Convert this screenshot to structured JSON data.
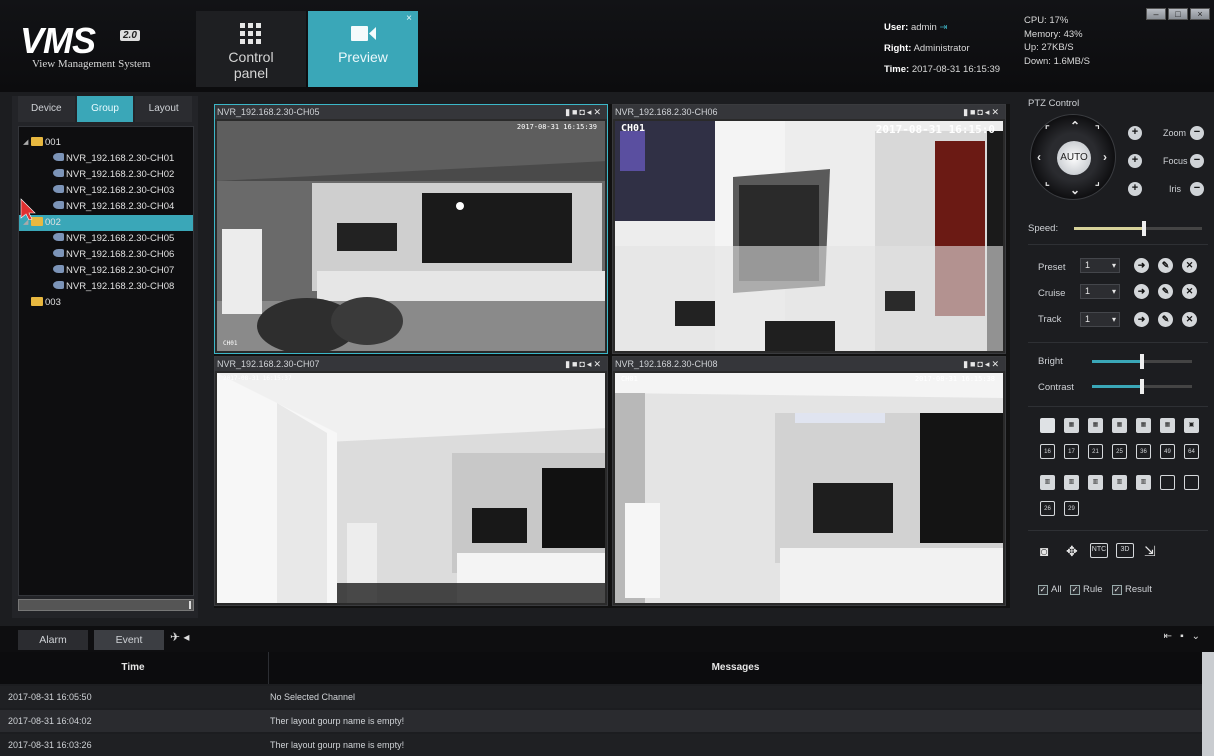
{
  "header": {
    "logo_text": "VMS",
    "logo_version": "2.0",
    "logo_subtitle": "View Management System",
    "tabs": [
      {
        "label": "Control panel",
        "active": false
      },
      {
        "label": "Preview",
        "active": true
      }
    ],
    "tab_close": "×",
    "user": {
      "user_label": "User:",
      "user_value": "admin",
      "right_label": "Right:",
      "right_value": "Administrator",
      "time_label": "Time:",
      "time_value": "2017-08-31 16:15:39"
    },
    "system": {
      "cpu": "CPU: 17%",
      "memory": "Memory: 43%",
      "up": "Up: 27KB/S",
      "down": "Down: 1.6MB/S"
    },
    "window_buttons": [
      "–",
      "□",
      "×"
    ]
  },
  "left_panel": {
    "tabs": [
      {
        "label": "Device",
        "active": false
      },
      {
        "label": "Group",
        "active": true
      },
      {
        "label": "Layout",
        "active": false
      }
    ],
    "tree": [
      {
        "label": "001",
        "type": "folder",
        "expand": "◢"
      },
      {
        "label": "NVR_192.168.2.30-CH01",
        "type": "camera"
      },
      {
        "label": "NVR_192.168.2.30-CH02",
        "type": "camera"
      },
      {
        "label": "NVR_192.168.2.30-CH03",
        "type": "camera"
      },
      {
        "label": "NVR_192.168.2.30-CH04",
        "type": "camera"
      },
      {
        "label": "002",
        "type": "folder",
        "selected": true,
        "expand": "◢"
      },
      {
        "label": "NVR_192.168.2.30-CH05",
        "type": "camera"
      },
      {
        "label": "NVR_192.168.2.30-CH06",
        "type": "camera"
      },
      {
        "label": "NVR_192.168.2.30-CH07",
        "type": "camera"
      },
      {
        "label": "NVR_192.168.2.30-CH08",
        "type": "camera"
      },
      {
        "label": "003",
        "type": "folder"
      }
    ]
  },
  "video": {
    "cells": [
      {
        "title": "NVR_192.168.2.30-CH05",
        "timestamp": "2017-08-31 16:15:39",
        "channel": "CH01",
        "active": true
      },
      {
        "title": "NVR_192.168.2.30-CH06",
        "timestamp": "2017-08-31 16:15:0",
        "channel": "CH01",
        "active": false
      },
      {
        "title": "NVR_192.168.2.30-CH07",
        "timestamp": "2017-08-31 16:15:37",
        "channel": "",
        "active": false
      },
      {
        "title": "NVR_192.168.2.30-CH08",
        "timestamp": "2017-08-31 16:15:38",
        "channel": "CH01",
        "active": false
      }
    ],
    "tool_glyphs": "▮■◘◂✕"
  },
  "ptz": {
    "title": "PTZ Control",
    "auto_label": "AUTO",
    "zoom_label": "Zoom",
    "focus_label": "Focus",
    "iris_label": "Iris",
    "speed_label": "Speed:",
    "speed_value": 0.55,
    "preset_label": "Preset",
    "cruise_label": "Cruise",
    "track_label": "Track",
    "preset_value": "1",
    "cruise_value": "1",
    "track_value": "1",
    "bright_label": "Bright",
    "contrast_label": "Contrast",
    "bright_value": 0.5,
    "contrast_value": 0.5
  },
  "layouts": {
    "row2": [
      "16",
      "17",
      "21",
      "25",
      "36",
      "49",
      "64"
    ],
    "row4": [
      "26",
      "29"
    ],
    "row3_icons": [
      "10",
      "12",
      "13",
      "14",
      "15",
      "18",
      "20"
    ]
  },
  "tools": {
    "btn_ntc": "NTC",
    "btn_3d": "3D"
  },
  "checks": [
    {
      "label": "All",
      "checked": true
    },
    {
      "label": "Rule",
      "checked": true
    },
    {
      "label": "Result",
      "checked": true
    }
  ],
  "bottom": {
    "tabs": [
      {
        "label": "Alarm",
        "active": false
      },
      {
        "label": "Event",
        "active": true
      }
    ],
    "columns": [
      "Time",
      "Messages"
    ],
    "rows": [
      {
        "time": "2017-08-31 16:05:50",
        "message": "No Selected Channel"
      },
      {
        "time": "2017-08-31 16:04:02",
        "message": "Ther layout gourp name is empty!"
      },
      {
        "time": "2017-08-31 16:03:26",
        "message": "Ther layout gourp name is empty!"
      }
    ]
  },
  "colors": {
    "accent": "#3aa7b8",
    "background": "#1c1d20",
    "folder": "#e8b840"
  }
}
